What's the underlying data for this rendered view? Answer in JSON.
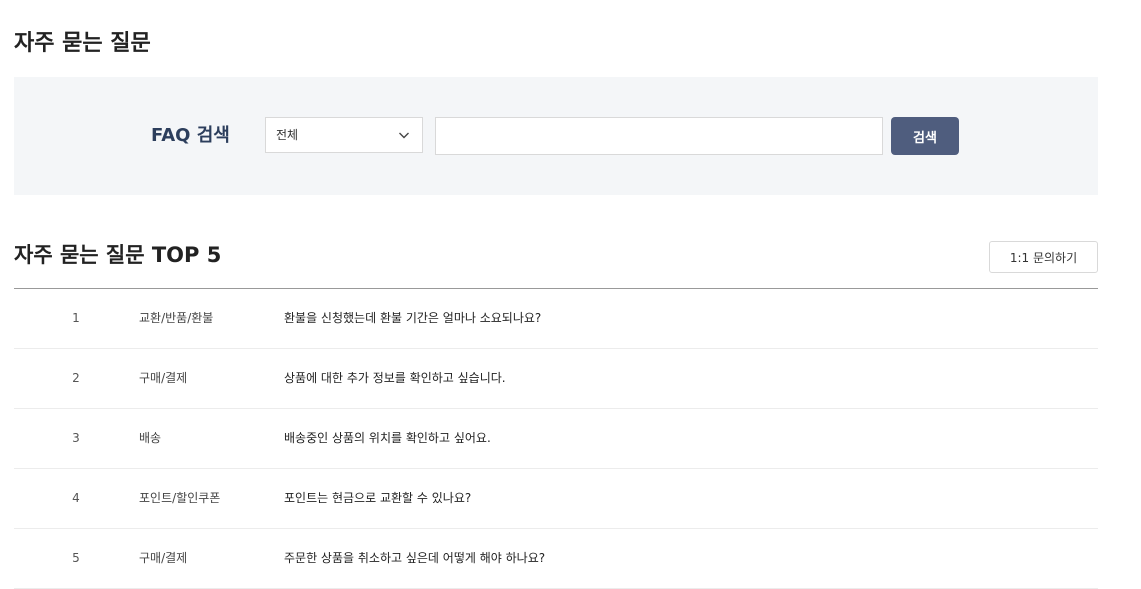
{
  "page": {
    "title": "자주 묻는 질문"
  },
  "search": {
    "label": "FAQ 검색",
    "category_selected": "전체",
    "input_value": "",
    "input_placeholder": "",
    "button_label": "검색"
  },
  "top5": {
    "title": "자주 묻는 질문 TOP 5",
    "inquiry_button_label": "1:1 문의하기",
    "items": [
      {
        "num": "1",
        "category": "교환/반품/환불",
        "question": "환불을 신청했는데 환불 기간은 얼마나 소요되나요?"
      },
      {
        "num": "2",
        "category": "구매/결제",
        "question": "상품에 대한 추가 정보를 확인하고 싶습니다."
      },
      {
        "num": "3",
        "category": "배송",
        "question": "배송중인 상품의 위치를 확인하고 싶어요."
      },
      {
        "num": "4",
        "category": "포인트/할인쿠폰",
        "question": "포인트는 현금으로 교환할 수 있나요?"
      },
      {
        "num": "5",
        "category": "구매/결제",
        "question": "주문한 상품을 취소하고 싶은데 어떻게 해야 하나요?"
      }
    ]
  },
  "colors": {
    "panel_background": "#f4f6f8",
    "search_button": "#4f5d7e",
    "search_label": "#2c3e5c"
  },
  "icons": {
    "select_arrow": "chevron-down-icon"
  }
}
